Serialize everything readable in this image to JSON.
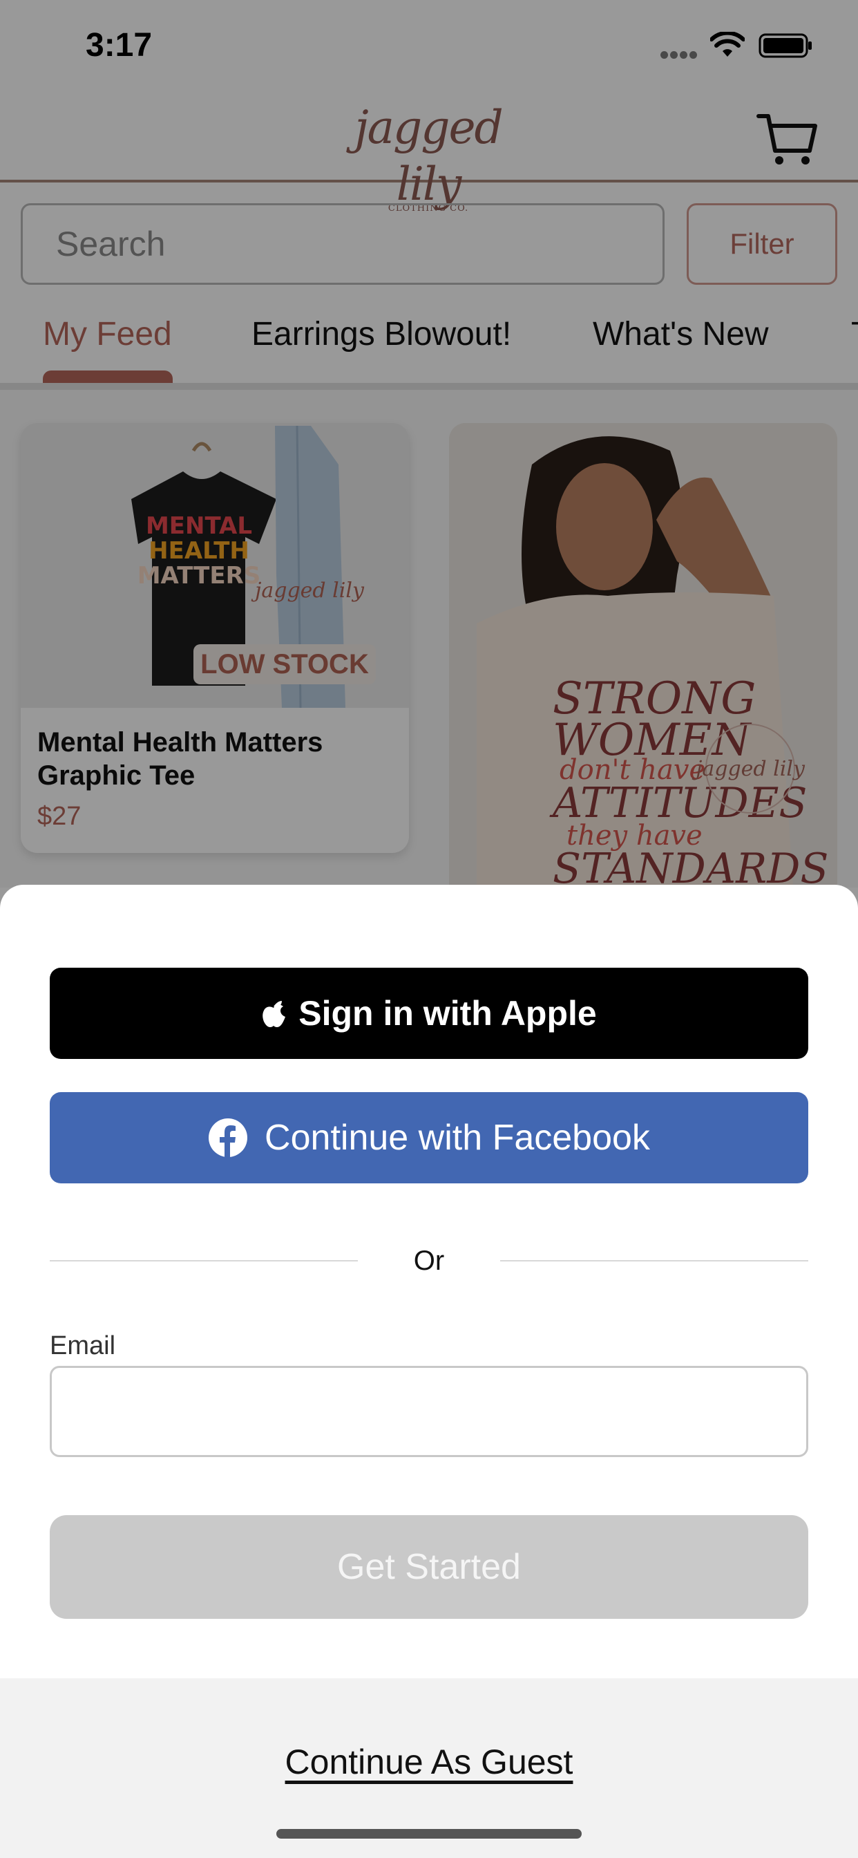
{
  "status_bar": {
    "time": "3:17"
  },
  "header": {
    "logo_text": "jagged lily",
    "logo_subtext": "CLOTHING CO.",
    "cart_icon": "cart-icon"
  },
  "search": {
    "placeholder": "Search",
    "filter_label": "Filter"
  },
  "tabs": [
    {
      "label": "My Feed",
      "active": true
    },
    {
      "label": "Earrings Blowout!",
      "active": false
    },
    {
      "label": "What's New",
      "active": false
    },
    {
      "label": "T",
      "active": false
    }
  ],
  "feed": {
    "cards": [
      {
        "image_text": "MENTAL HEALTH MATTERS",
        "badge": "LOW STOCK",
        "title": "Mental Health Matters Graphic Tee",
        "price": "$27"
      },
      {
        "image_text": "STRONG WOMEN don't have ATTITUDES they have STANDARDS"
      }
    ]
  },
  "login_sheet": {
    "apple_label": "Sign in with Apple",
    "facebook_label": "Continue with Facebook",
    "divider_text": "Or",
    "email_label": "Email",
    "email_value": "",
    "get_started_label": "Get Started",
    "guest_label": "Continue As Guest"
  },
  "colors": {
    "accent": "#b5665a",
    "facebook_blue": "#4267b2",
    "apple_black": "#000000",
    "disabled_button": "#c9c9c9"
  }
}
